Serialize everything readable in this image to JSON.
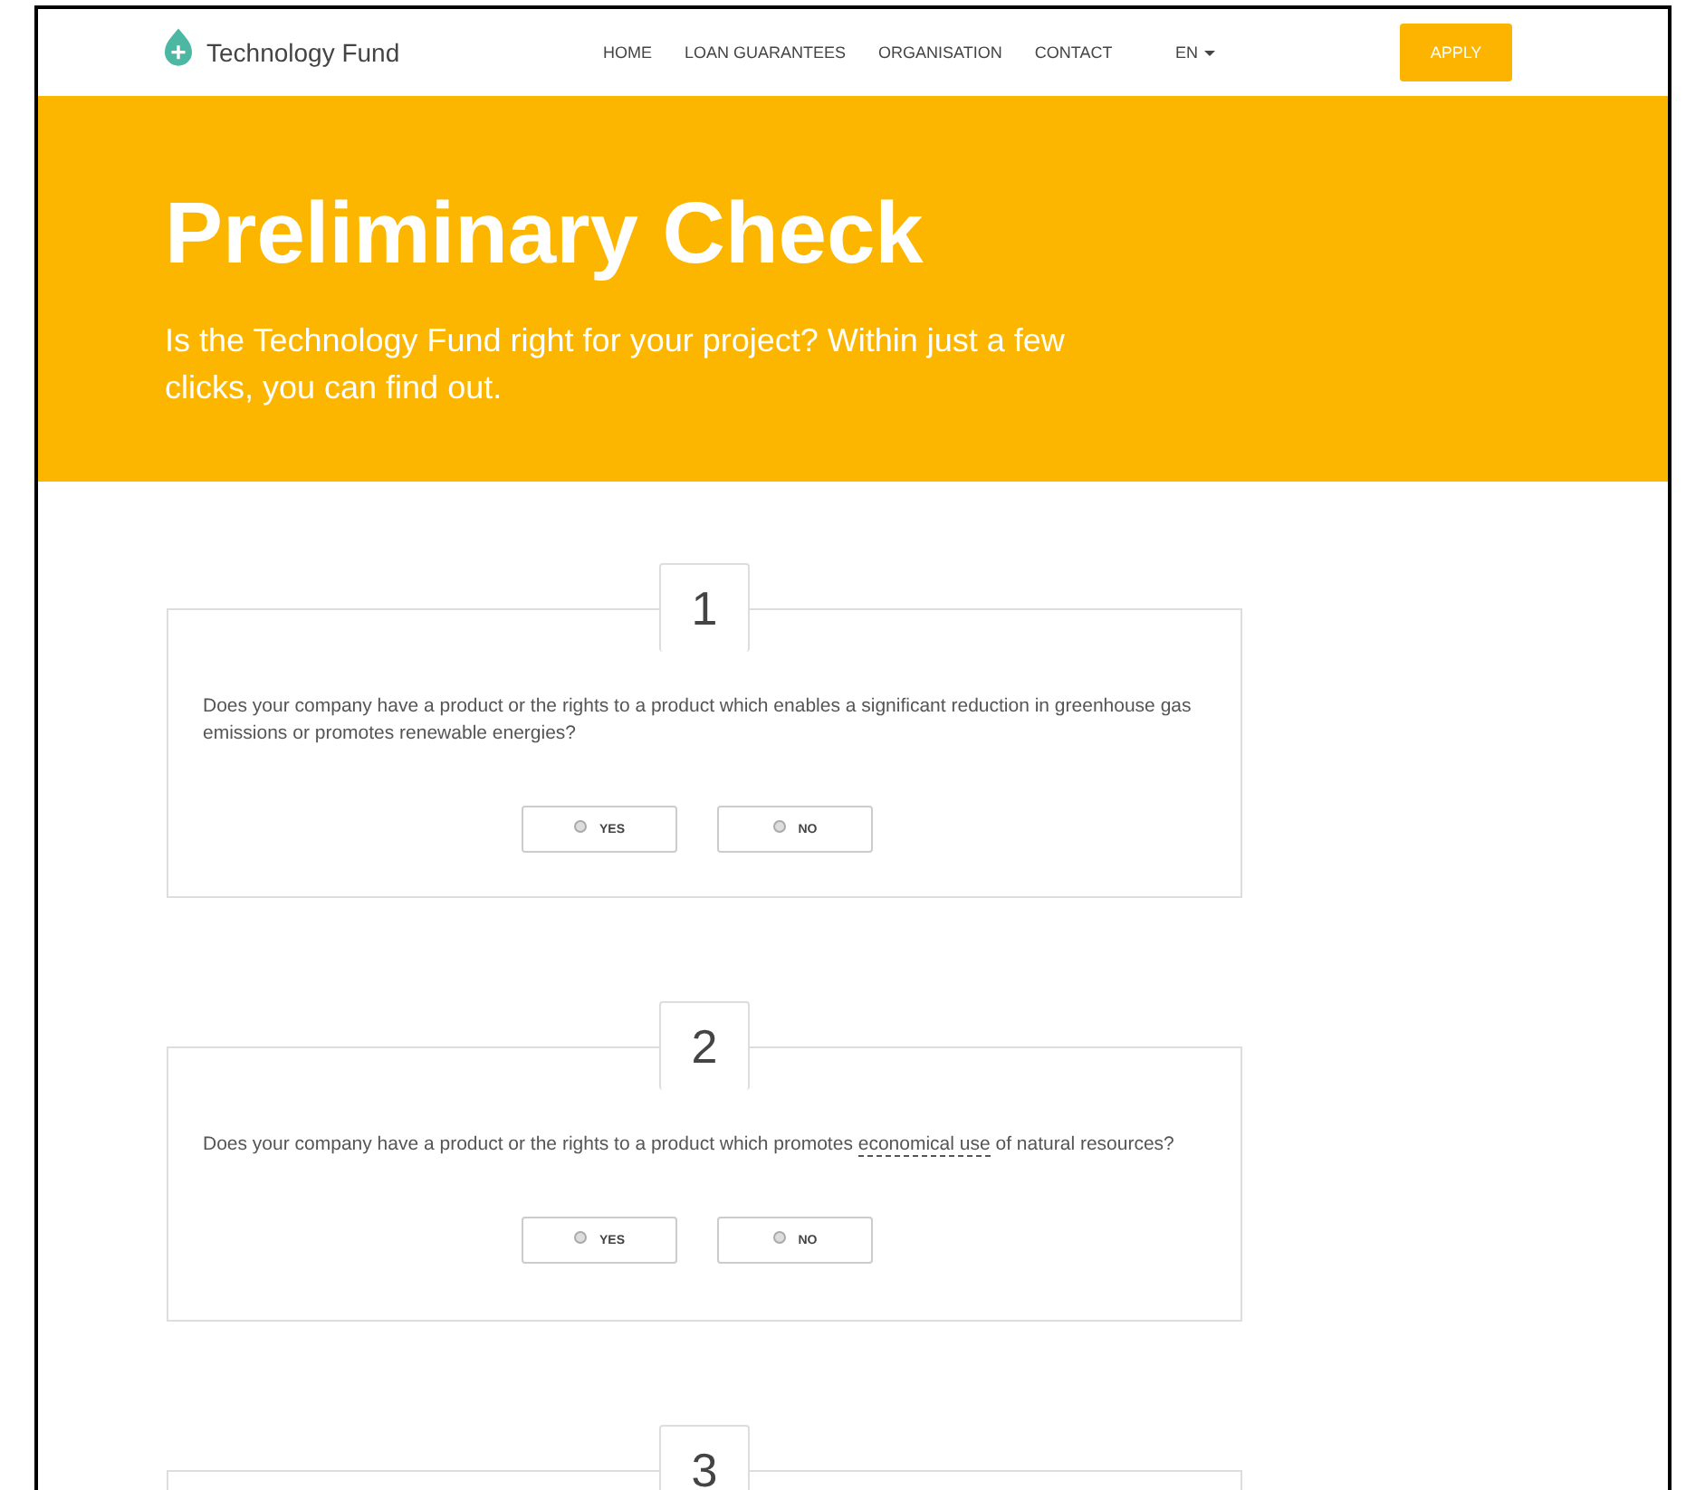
{
  "header": {
    "brand": "Technology Fund",
    "nav": [
      {
        "label": "HOME"
      },
      {
        "label": "LOAN GUARANTEES"
      },
      {
        "label": "ORGANISATION"
      },
      {
        "label": "CONTACT"
      }
    ],
    "language": "EN",
    "apply": "APPLY"
  },
  "hero": {
    "title": "Preliminary Check",
    "subtitle": "Is the Technology Fund right for your project? Within just a few clicks, you can find out."
  },
  "questions": [
    {
      "number": "1",
      "segments": [
        {
          "kind": "plain",
          "text": "Does your company have a product or the rights to a product which enables a significant reduction in greenhouse gas emissions or promotes renewable energies?"
        }
      ],
      "options": [
        {
          "label": "YES",
          "selected": false
        },
        {
          "label": "NO",
          "selected": false
        }
      ]
    },
    {
      "number": "2",
      "segments": [
        {
          "kind": "plain",
          "text": "Does your company have a product or the rights to a product which promotes "
        },
        {
          "kind": "term",
          "text": "economical use"
        },
        {
          "kind": "plain",
          "text": " of natural resources?"
        }
      ],
      "options": [
        {
          "label": "YES",
          "selected": false
        },
        {
          "label": "NO",
          "selected": false
        }
      ]
    },
    {
      "number": "3"
    }
  ]
}
